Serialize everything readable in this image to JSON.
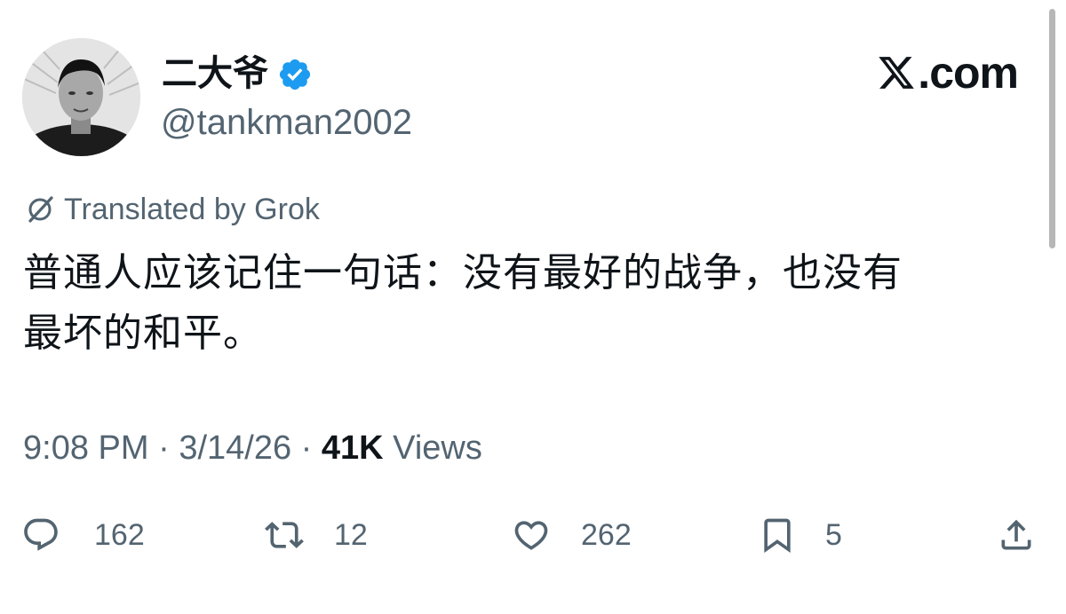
{
  "author": {
    "display_name": "二大爷",
    "handle": "@tankman2002",
    "verified": true
  },
  "brand": {
    "logo_text": ".com",
    "accent_color": "#1d9bf0"
  },
  "translation": {
    "label": "Translated by Grok",
    "icon": "grok-icon"
  },
  "tweet": {
    "text_line1": "普通人应该记住一句话：没有最好的战争，也没有",
    "text_line2": "最坏的和平。"
  },
  "meta": {
    "time": "9:08 PM",
    "separator": " · ",
    "date": "3/14/26",
    "separator2": " · ",
    "views_count": "41K",
    "views_label": " Views"
  },
  "actions": {
    "replies": "162",
    "reposts": "12",
    "likes": "262",
    "bookmarks": "5"
  },
  "icons": {
    "reply": "speech-bubble-icon",
    "repost": "repost-icon",
    "like": "heart-icon",
    "bookmark": "bookmark-icon",
    "share": "share-icon",
    "verified": "verified-badge-icon"
  },
  "colors": {
    "text_primary": "#0f1419",
    "text_secondary": "#536471",
    "verified_blue": "#1d9bf0"
  }
}
